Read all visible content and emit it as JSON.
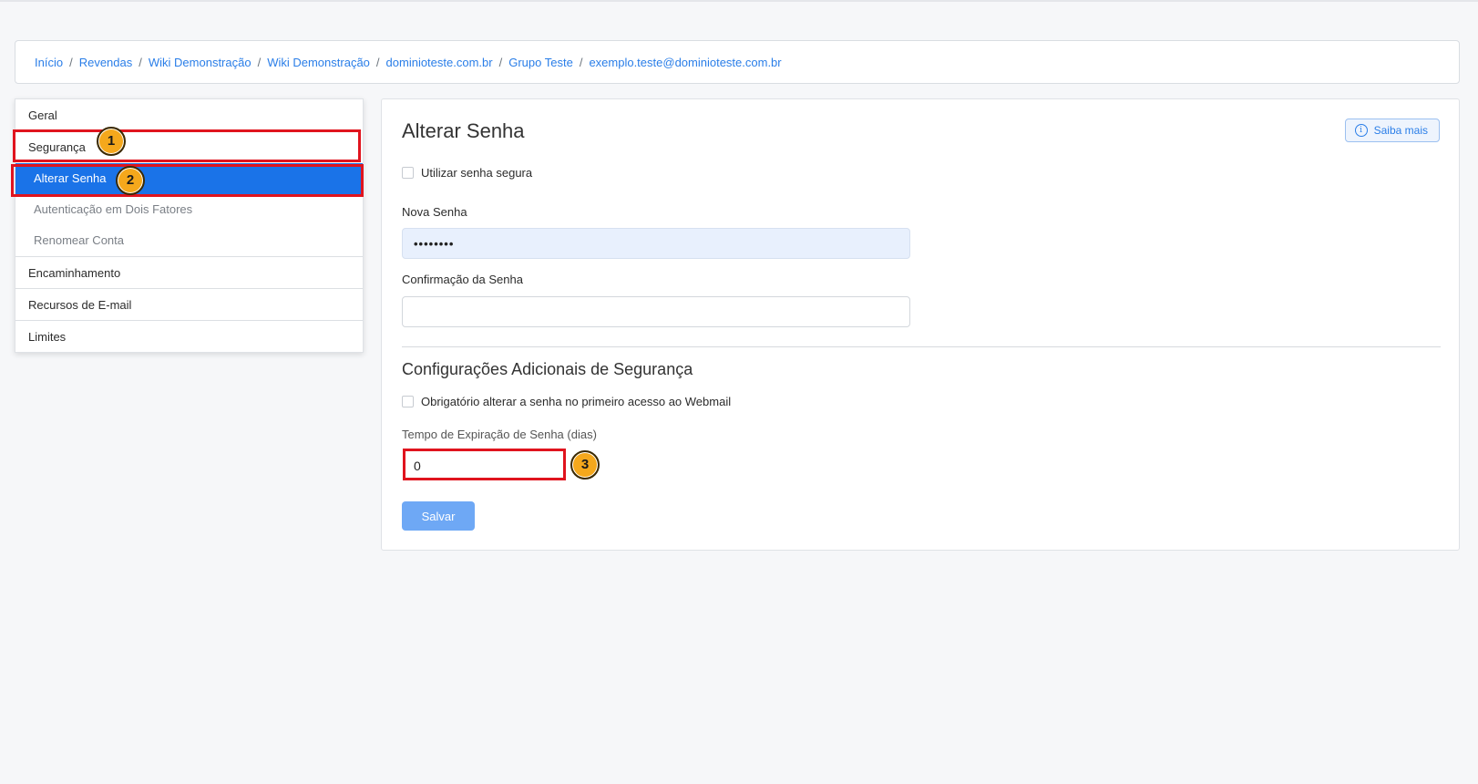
{
  "breadcrumb": [
    "Início",
    "Revendas",
    "Wiki Demonstração",
    "Wiki Demonstração",
    "dominioteste.com.br",
    "Grupo Teste",
    "exemplo.teste@dominioteste.com.br"
  ],
  "breadcrumb_separator": "/",
  "sidebar": {
    "geral": "Geral",
    "seguranca": "Segurança",
    "sub_items": [
      "Alterar Senha",
      "Autenticação em Dois Fatores",
      "Renomear Conta"
    ],
    "encaminhamento": "Encaminhamento",
    "recursos": "Recursos de E-mail",
    "limites": "Limites"
  },
  "main": {
    "title": "Alterar Senha",
    "saiba_mais": "Saiba mais",
    "secure_password_label": "Utilizar senha segura",
    "new_password_label": "Nova Senha",
    "new_password_value": "••••••••",
    "confirm_label": "Confirmação da Senha",
    "confirm_value": "",
    "extra_section_title": "Configurações Adicionais de Segurança",
    "force_change_label": "Obrigatório alterar a senha no primeiro acesso ao Webmail",
    "expiration_label": "Tempo de Expiração de Senha (dias)",
    "expiration_value": "0",
    "save_label": "Salvar"
  },
  "annotations": [
    "1",
    "2",
    "3"
  ],
  "colors": {
    "accent": "#1a73e8",
    "link": "#2a7ee8",
    "annotation_border": "#e0141e",
    "annotation_badge": "#f5a81c",
    "save_button": "#6ea8f5"
  }
}
